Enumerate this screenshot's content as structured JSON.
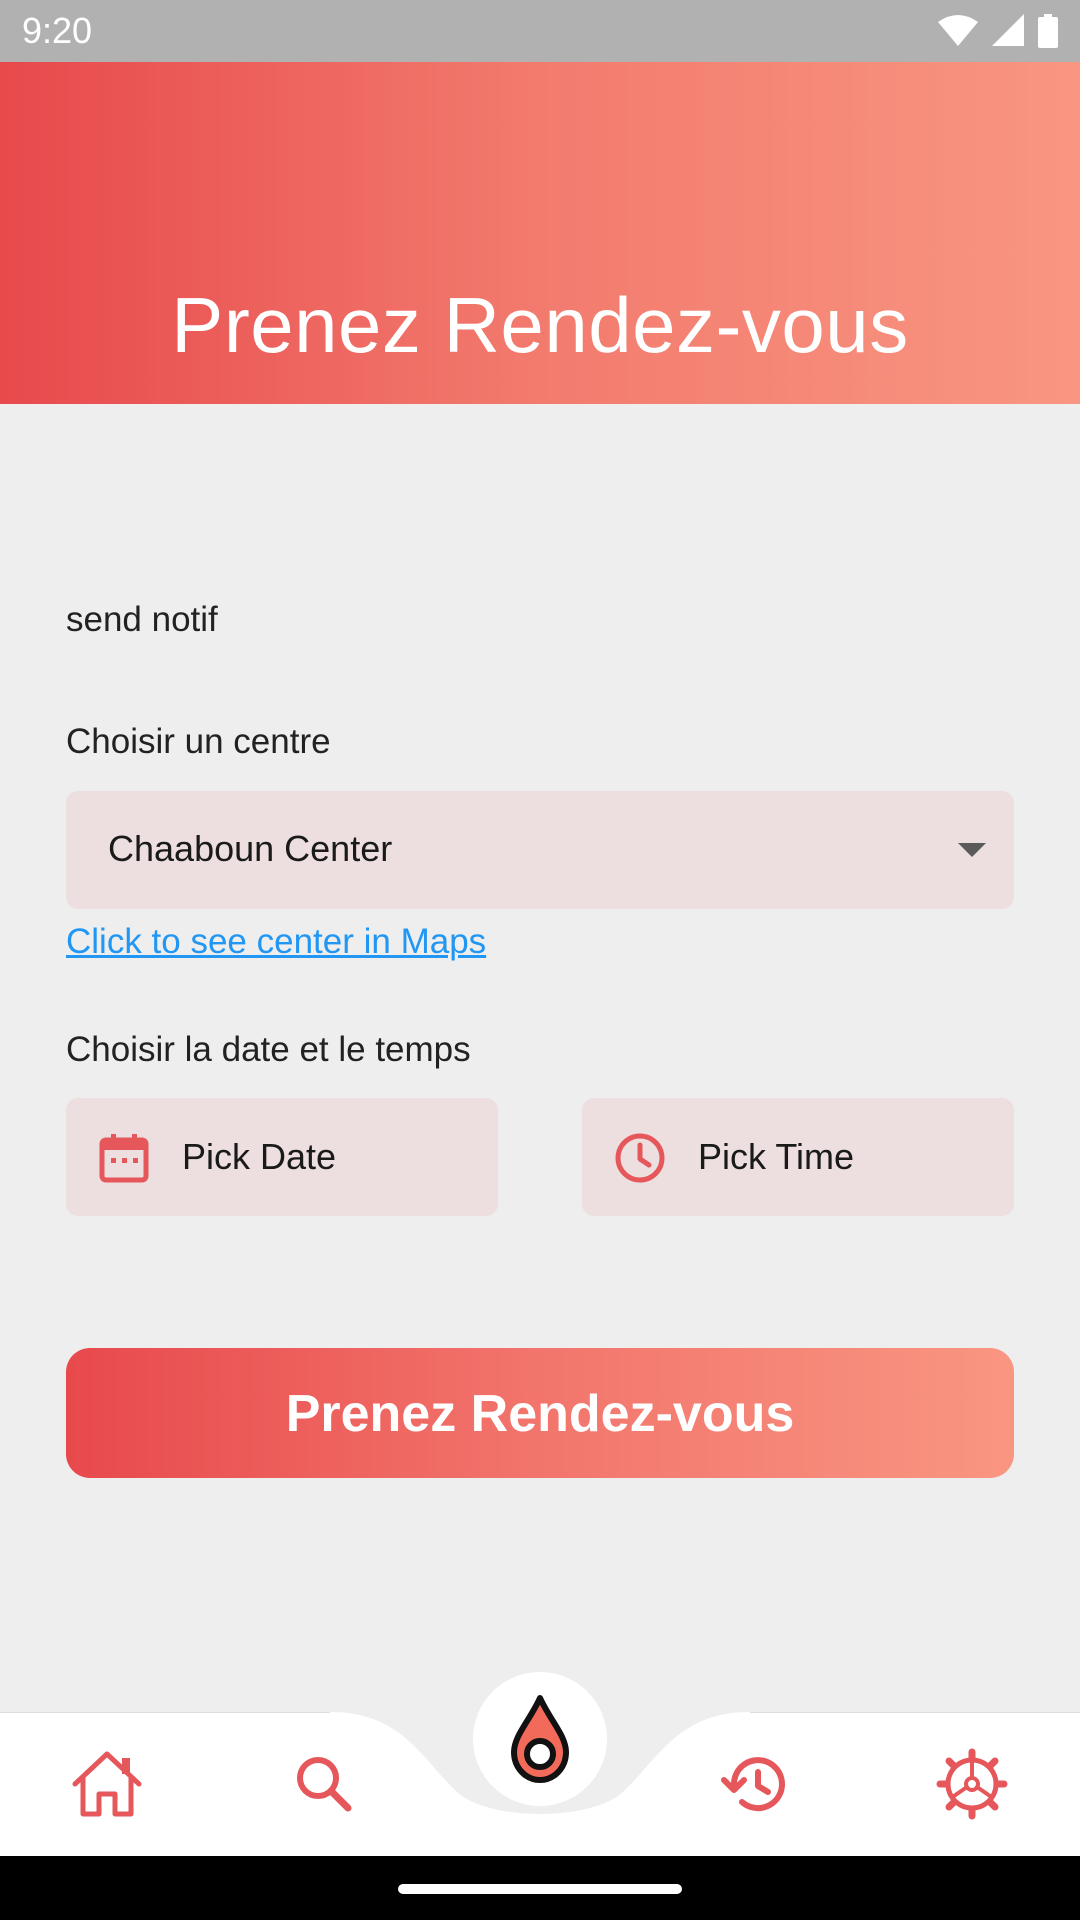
{
  "status_bar": {
    "time": "9:20"
  },
  "header": {
    "title": "Prenez Rendez-vous"
  },
  "form": {
    "send_notif": "send notif",
    "centre_label": "Choisir un centre",
    "centre_selected": "Chaaboun Center",
    "maps_link": "Click to see center in Maps",
    "datetime_label": "Choisir la date et le temps",
    "pick_date": "Pick Date",
    "pick_time": "Pick Time",
    "submit": "Prenez Rendez-vous"
  },
  "bottom_nav": {
    "items": [
      "home-icon",
      "search-icon",
      "blood-drop-icon",
      "history-icon",
      "settings-icon"
    ]
  },
  "colors": {
    "accent": "#e8494c",
    "accent_light": "#f99682",
    "link": "#2196f3",
    "field_bg": "#eddfdf",
    "icon": "#e5575a"
  }
}
